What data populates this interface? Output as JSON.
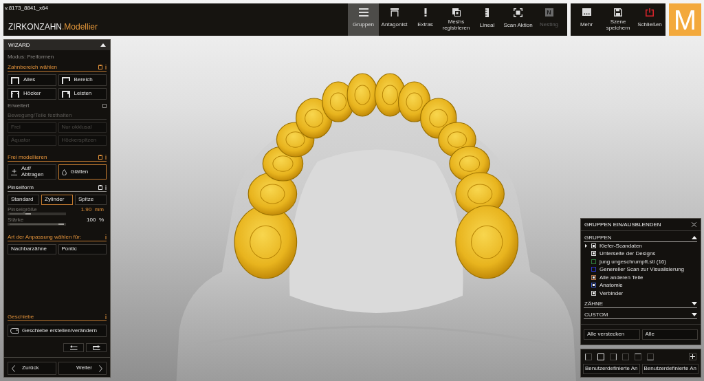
{
  "version": "v.8173_8841_x64",
  "app_title": {
    "brand": "ZIRKONZAHN",
    "product": ".Modellier"
  },
  "toolbar": [
    {
      "label": "Gruppen",
      "selected": true,
      "disabled": false
    },
    {
      "label": "Antagonist",
      "selected": false,
      "disabled": false
    },
    {
      "label": "Extras",
      "selected": false,
      "disabled": false
    },
    {
      "label": "Meshs\nregistrieren",
      "selected": false,
      "disabled": false
    },
    {
      "label": "Lineal",
      "selected": false,
      "disabled": false
    },
    {
      "label": "Scan Aktion",
      "selected": false,
      "disabled": false
    },
    {
      "label": "Nesting",
      "selected": false,
      "disabled": true,
      "glyph": "N"
    }
  ],
  "actions": [
    {
      "label": "Mehr"
    },
    {
      "label": "Szene\nspeichern"
    },
    {
      "label": "Schließen"
    }
  ],
  "logo": "M",
  "wizard": {
    "title": "WIZARD",
    "expanded": true,
    "mode": "Modus: Freiformen",
    "zahnbereich": {
      "title": "Zahnbereich wählen",
      "highlighted": true,
      "options": [
        "Alles",
        "Bereich",
        "Höcker",
        "Leisten"
      ]
    },
    "advanced": {
      "label": "Erweitert",
      "checked": false
    },
    "fixieren": {
      "title": "Bewegung/Teile festhalten",
      "disabled": true,
      "options": [
        "Frei",
        "Nur okklusal",
        "Äquator",
        "Höckerspitzen"
      ]
    },
    "modeling": {
      "title": "Frei modellieren",
      "highlighted": true,
      "tools": [
        {
          "label": "Auf/\nAbtragen",
          "selected": false
        },
        {
          "label": "Glätten",
          "selected": true
        }
      ]
    },
    "brush": {
      "title": "Pinselform",
      "highlighted": false,
      "shapes": [
        {
          "label": "Standard",
          "selected": false
        },
        {
          "label": "Zylinder",
          "selected": true
        },
        {
          "label": "Spitze",
          "selected": false
        }
      ]
    },
    "sliders": [
      {
        "label": "Pinselgröße",
        "level": 0.4,
        "value": "1.90",
        "unit": "mm",
        "highlighted": true
      },
      {
        "label": "Stärke",
        "level": 1,
        "value": "100",
        "unit": "%",
        "highlighted": false
      }
    ],
    "adaptation": {
      "title": "Art der Anpassung wählen für:",
      "highlighted": true,
      "options": [
        "Nachbarzähne",
        "Pontic"
      ]
    },
    "attachment": {
      "title": "Geschiebe",
      "highlighted": true,
      "button": "Geschiebe erstellen/verändern"
    },
    "back": "Zurück",
    "next": "Weiter"
  },
  "groups_panel": {
    "title": "GRUPPEN EIN/AUSBLENDEN",
    "sections": [
      {
        "title": "GRUPPEN",
        "expanded": true,
        "items": [
          {
            "label": "Kiefer-Scandaten",
            "kind": "branch",
            "checked": true,
            "color": "#d8d8d8"
          },
          {
            "label": "Unterseite der Designs",
            "kind": "leaf",
            "checked": true,
            "color": "#d8d8d8"
          },
          {
            "label": "jung ungeschrumpft.stl (16)",
            "kind": "leaf",
            "checked": false,
            "color": "#2f7a3c"
          },
          {
            "label": "Genereller Scan zur Visualisierung",
            "kind": "leaf",
            "checked": false,
            "color": "#2b35c8"
          },
          {
            "label": "Alle anderen Teile",
            "kind": "leaf",
            "checked": true,
            "color": "#b0704a"
          },
          {
            "label": "Anatomie",
            "kind": "leaf",
            "checked": true,
            "color": "#3a5cc8"
          },
          {
            "label": "Verbinder",
            "kind": "leaf",
            "checked": true,
            "color": "#d8d8d8"
          }
        ]
      },
      {
        "title": "ZÄHNE",
        "expanded": false
      },
      {
        "title": "CUSTOM",
        "expanded": false
      }
    ],
    "buttons": [
      "Alle verstecken",
      "Alle"
    ]
  },
  "view_buttons": [
    {
      "selected": false
    },
    {
      "selected": true
    },
    {
      "selected": false
    },
    {
      "selected": false
    },
    {
      "selected": false
    },
    {
      "selected": false
    }
  ],
  "custom_buttons": [
    "Benutzerdefinierte An",
    "Benutzerdefinierte An"
  ]
}
